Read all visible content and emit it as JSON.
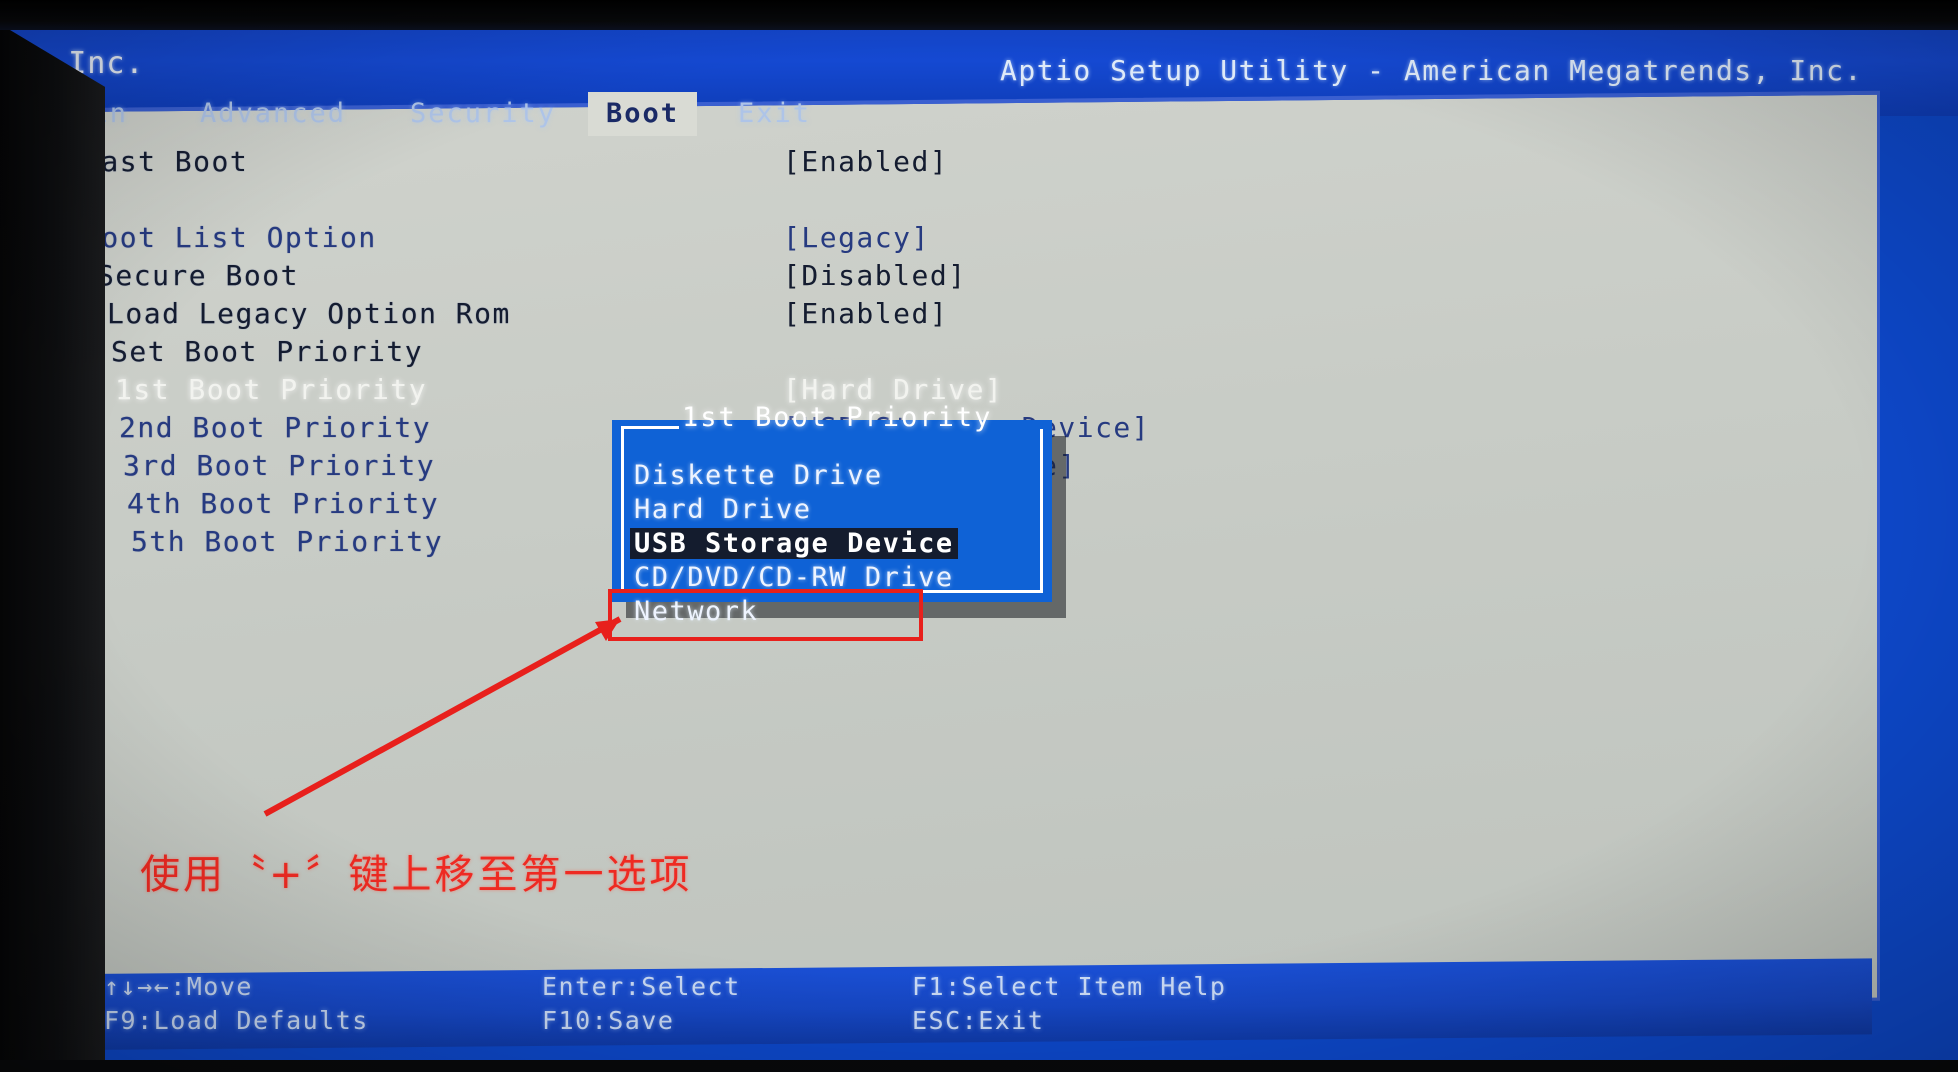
{
  "header": {
    "vendor": "ell Inc.",
    "app_title": "Aptio Setup Utility - American Megatrends, Inc."
  },
  "tabs": [
    {
      "label": "Main",
      "active": false
    },
    {
      "label": "Advanced",
      "active": false
    },
    {
      "label": "Security",
      "active": false
    },
    {
      "label": "Boot",
      "active": true
    },
    {
      "label": "Exit",
      "active": false
    }
  ],
  "settings": [
    {
      "label": "Fast Boot",
      "value": "[Enabled]",
      "selected": false
    },
    {
      "label": "Boot List Option",
      "value": "[Legacy]",
      "selected": false
    },
    {
      "label": "Secure Boot",
      "value": "[Disabled]",
      "selected": false
    },
    {
      "label": "Load Legacy Option Rom",
      "value": "[Enabled]",
      "selected": false
    },
    {
      "label": "Set Boot Priority",
      "value": "",
      "selected": false
    },
    {
      "label": "1st Boot Priority",
      "value": "[Hard Drive]",
      "selected": true
    },
    {
      "label": "2nd Boot Priority",
      "value": "[USB Storage Device]",
      "selected": false
    },
    {
      "label": "3rd Boot Priority",
      "value": "[Diskette Drive]",
      "selected": false
    },
    {
      "label": "4th Boot Priority",
      "value": "",
      "selected": false
    },
    {
      "label": "5th Boot Priority",
      "value": "",
      "selected": false
    }
  ],
  "dialog": {
    "title": "1st Boot Priority",
    "options": [
      {
        "label": "Diskette Drive",
        "highlighted": false
      },
      {
        "label": "Hard Drive",
        "highlighted": false
      },
      {
        "label": "USB Storage Device",
        "highlighted": true
      },
      {
        "label": "CD/DVD/CD-RW Drive",
        "highlighted": false
      },
      {
        "label": "Network",
        "highlighted": false
      }
    ]
  },
  "annotation": {
    "text": "使用〝+〞键上移至第一选项",
    "color": "#ee2a22"
  },
  "statusbar": {
    "items": [
      {
        "label": "↑↓→←:Move",
        "col": 0,
        "line": 0
      },
      {
        "label": "Enter:Select",
        "col": 1,
        "line": 0
      },
      {
        "label": "F1:Select Item Help",
        "col": 2,
        "line": 0
      },
      {
        "label": "F9:Load Defaults",
        "col": 0,
        "line": 1
      },
      {
        "label": "F10:Save",
        "col": 1,
        "line": 1
      },
      {
        "label": "ESC:Exit",
        "col": 2,
        "line": 1
      }
    ]
  },
  "colors": {
    "screen_blue": "#0d47c8",
    "panel_grey": "#cfd2cc",
    "label_blue": "#263a80",
    "dialog_blue": "#0f62d6",
    "highlight_dark": "#141c2e",
    "annotation_red": "#ee2a22"
  }
}
